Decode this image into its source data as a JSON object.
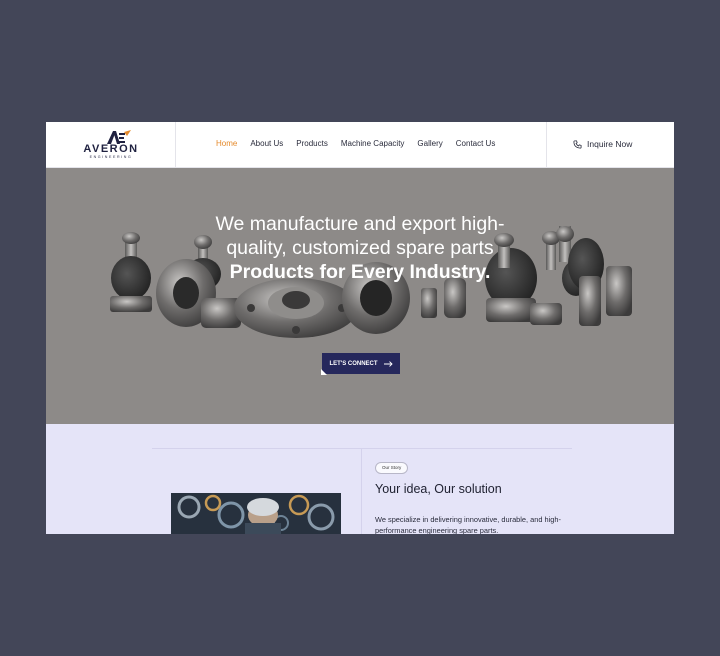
{
  "logo": {
    "word": "AVERON",
    "sub": "ENGINEERING"
  },
  "nav": {
    "items": [
      {
        "label": "Home",
        "active": true
      },
      {
        "label": "About Us"
      },
      {
        "label": "Products"
      },
      {
        "label": "Machine Capacity"
      },
      {
        "label": "Gallery"
      },
      {
        "label": "Contact Us"
      }
    ],
    "inquire_label": "Inquire Now",
    "inquire_icon": "phone-icon"
  },
  "hero": {
    "line1": "We manufacture and export high-",
    "line2": "quality, customized spare parts",
    "line3": "Products for Every Industry.",
    "cta_label": "LET'S CONNECT",
    "cta_icon": "arrow-right-icon"
  },
  "story": {
    "badge": "Our Story",
    "title": "Your idea, Our solution",
    "text": "We specialize in delivering innovative, durable, and high-performance engineering spare parts."
  },
  "colors": {
    "page_bg": "#434658",
    "accent": "#e58a2b",
    "navy": "#26285c",
    "hero_bg": "#8d8a88",
    "story_bg": "#e5e4f8"
  }
}
